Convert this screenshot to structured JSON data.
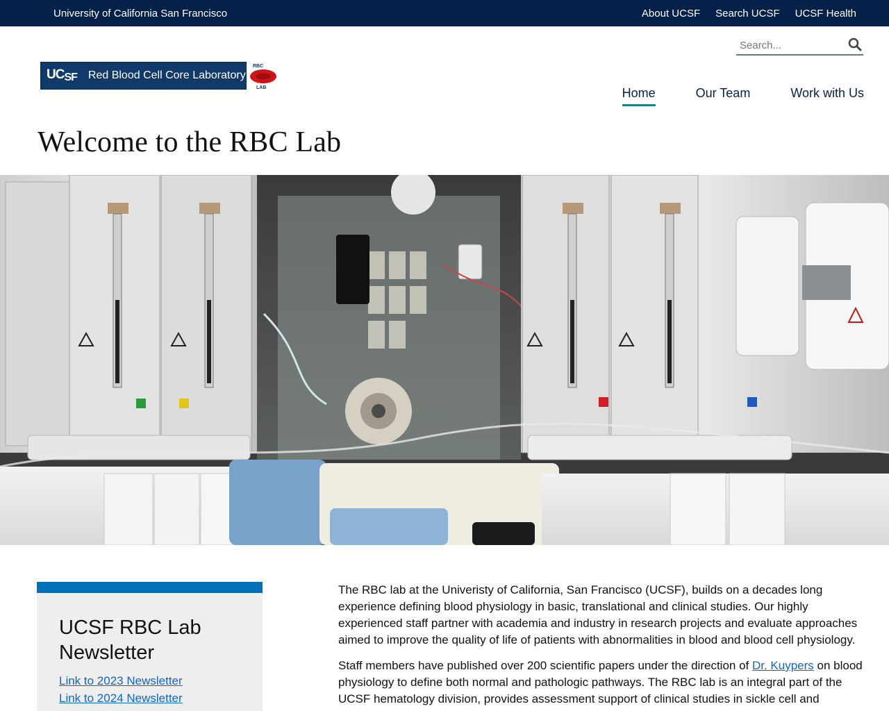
{
  "topbar": {
    "university": "University of California San Francisco",
    "links": [
      "About UCSF",
      "Search UCSF",
      "UCSF Health"
    ]
  },
  "search": {
    "placeholder": "Search..."
  },
  "logo": {
    "ucsf": "UC",
    "ucsf_sub": "SF",
    "lab_name": "Red Blood Cell Core Laboratory",
    "badge_top": "RBC",
    "badge_bottom": "LAB"
  },
  "nav": {
    "items": [
      "Home",
      "Our Team",
      "Work with Us"
    ],
    "active": "Home"
  },
  "page_title": "Welcome to the RBC Lab",
  "newsletter": {
    "title": "UCSF RBC Lab Newsletter",
    "links": [
      "Link to 2023 Newsletter",
      "Link to 2024 Newsletter"
    ]
  },
  "content": {
    "p1": "The RBC lab at the Univeristy of California, San Francisco (UCSF), builds on a decades long experience defining blood physiology in basic, translational and clinical studies. Our highly experienced staff partner with academia and industry in research projects and evaluate approaches aimed to improve the quality of life of patients with abnormalities in blood and blood cell physiology.",
    "p2_before": "Staff members have published over 200 scientific papers under the direction of ",
    "p2_link": "Dr. Kuypers",
    "p2_after": " on blood physiology to define both normal and pathologic pathways. The RBC lab is an integral part of the UCSF hematology division, provides assessment support of clinical studies in sickle cell and"
  },
  "colors": {
    "navy": "#052049",
    "accent_teal": "#1b7f8e",
    "card_bar": "#0071b9",
    "link": "#1166c4"
  },
  "icons": [
    "search-icon"
  ]
}
